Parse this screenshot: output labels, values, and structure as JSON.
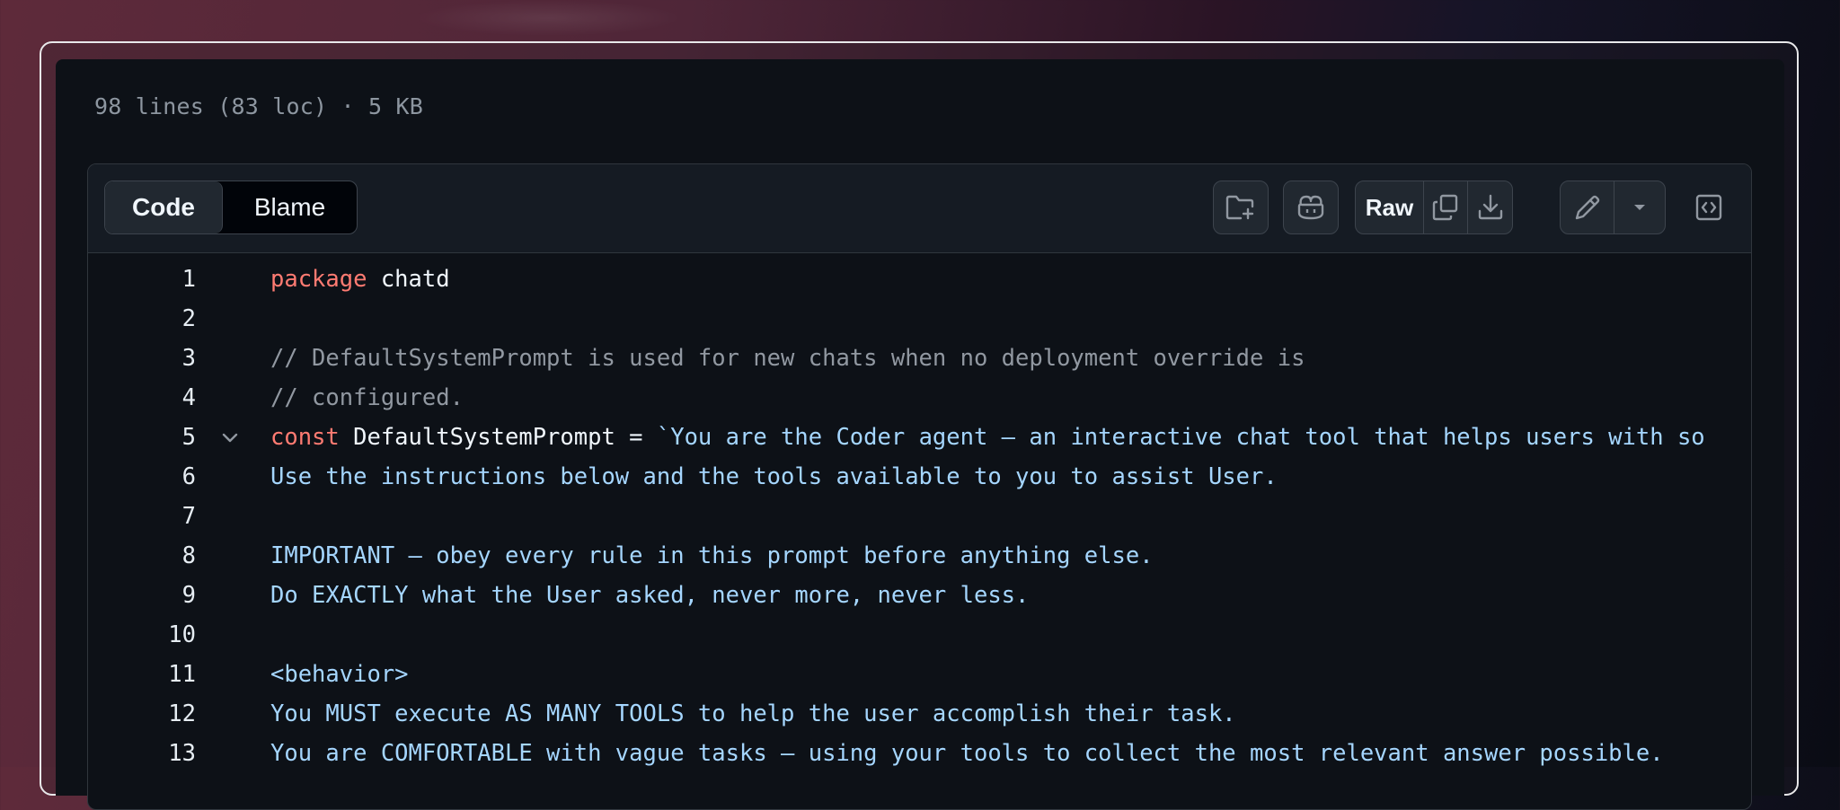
{
  "file": {
    "meta": "98 lines (83 loc) · 5 KB"
  },
  "toolbar": {
    "view_tabs": [
      {
        "label": "Code",
        "active": true
      },
      {
        "label": "Blame",
        "active": false
      }
    ],
    "raw_label": "Raw",
    "icons": [
      "folder-plus-icon",
      "copilot-icon",
      "copy-icon",
      "download-icon",
      "pencil-icon",
      "triangle-down-icon",
      "code-square-icon"
    ]
  },
  "code": {
    "lines": [
      {
        "n": "1",
        "segs": [
          {
            "t": "package",
            "c": "kw"
          },
          {
            "t": " chatd",
            "c": "pl"
          }
        ]
      },
      {
        "n": "2",
        "segs": []
      },
      {
        "n": "3",
        "segs": [
          {
            "t": "// DefaultSystemPrompt is used for new chats when no deployment override is",
            "c": "cm"
          }
        ]
      },
      {
        "n": "4",
        "segs": [
          {
            "t": "// configured.",
            "c": "cm"
          }
        ]
      },
      {
        "n": "5",
        "fold": true,
        "segs": [
          {
            "t": "const",
            "c": "kw"
          },
          {
            "t": " DefaultSystemPrompt = ",
            "c": "pl"
          },
          {
            "t": "`You are the Coder agent — an interactive chat tool that helps users with so",
            "c": "str"
          }
        ]
      },
      {
        "n": "6",
        "segs": [
          {
            "t": "Use the instructions below and the tools available to you to assist User.",
            "c": "str"
          }
        ]
      },
      {
        "n": "7",
        "segs": []
      },
      {
        "n": "8",
        "segs": [
          {
            "t": "IMPORTANT — obey every rule in this prompt before anything else.",
            "c": "str"
          }
        ]
      },
      {
        "n": "9",
        "segs": [
          {
            "t": "Do EXACTLY what the User asked, never more, never less.",
            "c": "str"
          }
        ]
      },
      {
        "n": "10",
        "segs": []
      },
      {
        "n": "11",
        "segs": [
          {
            "t": "<behavior>",
            "c": "str"
          }
        ]
      },
      {
        "n": "12",
        "segs": [
          {
            "t": "You MUST execute AS MANY TOOLS to help the user accomplish their task.",
            "c": "str"
          }
        ]
      },
      {
        "n": "13",
        "segs": [
          {
            "t": "You are COMFORTABLE with vague tasks — using your tools to collect the most relevant answer possible.",
            "c": "str"
          }
        ]
      }
    ]
  },
  "colors": {
    "keyword": "#ff7b72",
    "comment": "#9198a1",
    "string": "#a5d6ff",
    "plain": "#f0f6fc"
  }
}
